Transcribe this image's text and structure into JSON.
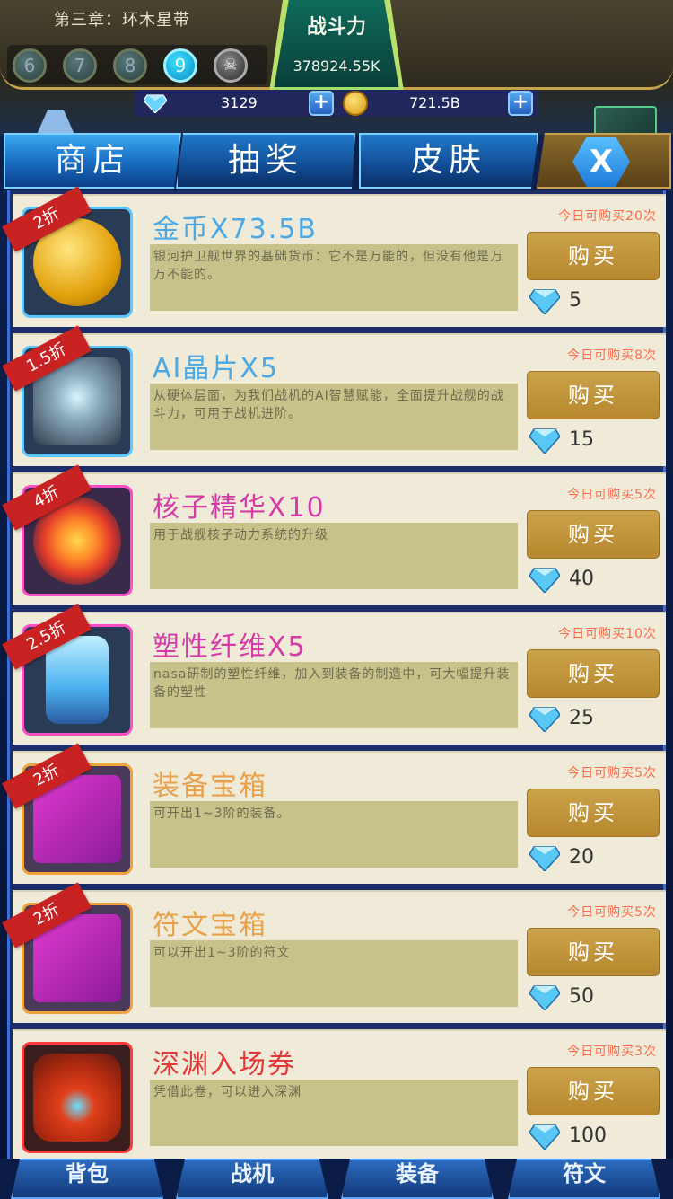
{
  "header": {
    "chapter": "第三章：环木星带",
    "stages": [
      "6",
      "7",
      "8",
      "9",
      "☠"
    ],
    "power_label": "战斗力",
    "power_value": "378924.55K",
    "gems": "3129",
    "coins": "721.5B"
  },
  "tabs": [
    {
      "label": "商店"
    },
    {
      "label": "抽奖"
    },
    {
      "label": "皮肤"
    }
  ],
  "close_label": "X",
  "items": [
    {
      "name": "金币X73.5B",
      "name_color": "#4aa8e6",
      "desc": "银河护卫舰世界的基础货币：它不是万能的，但没有他是万万不能的。",
      "limit": "今日可购买20次",
      "buy": "购买",
      "price": "5",
      "badge": "2折",
      "icon": "gold-coin-icon"
    },
    {
      "name": "AI晶片X5",
      "name_color": "#4aa8e6",
      "desc": "从硬体层面，为我们战机的AI智慧赋能，全面提升战舰的战斗力，可用于战机进阶。",
      "limit": "今日可购买8次",
      "buy": "购买",
      "price": "15",
      "badge": "1.5折",
      "icon": "ai-chip-icon"
    },
    {
      "name": "核子精华X10",
      "name_color": "#d63aa6",
      "desc": "用于战舰核子动力系统的升级",
      "limit": "今日可购买5次",
      "buy": "购买",
      "price": "40",
      "badge": "4折",
      "icon": "nuclear-essence-icon"
    },
    {
      "name": "塑性纤维X5",
      "name_color": "#d63aa6",
      "desc": "nasa研制的塑性纤维，加入到装备的制造中，可大幅提升装备的塑性",
      "limit": "今日可购买10次",
      "buy": "购买",
      "price": "25",
      "badge": "2.5折",
      "icon": "plastic-fiber-icon"
    },
    {
      "name": "装备宝箱",
      "name_color": "#e8a04a",
      "desc": "可开出1~3阶的装备。",
      "limit": "今日可购买5次",
      "buy": "购买",
      "price": "20",
      "badge": "2折",
      "icon": "mystery-box-icon"
    },
    {
      "name": "符文宝箱",
      "name_color": "#e8a04a",
      "desc": "可以开出1~3阶的符文",
      "limit": "今日可购买5次",
      "buy": "购买",
      "price": "50",
      "badge": "2折",
      "icon": "mystery-box-icon"
    },
    {
      "name": "深渊入场券",
      "name_color": "#e23a3a",
      "desc": "凭借此卷，可以进入深渊",
      "limit": "今日可购买3次",
      "buy": "购买",
      "price": "100",
      "badge": "",
      "icon": "abyss-ticket-icon"
    }
  ],
  "bottom_nav": [
    "背包",
    "战机",
    "装备",
    "符文"
  ]
}
